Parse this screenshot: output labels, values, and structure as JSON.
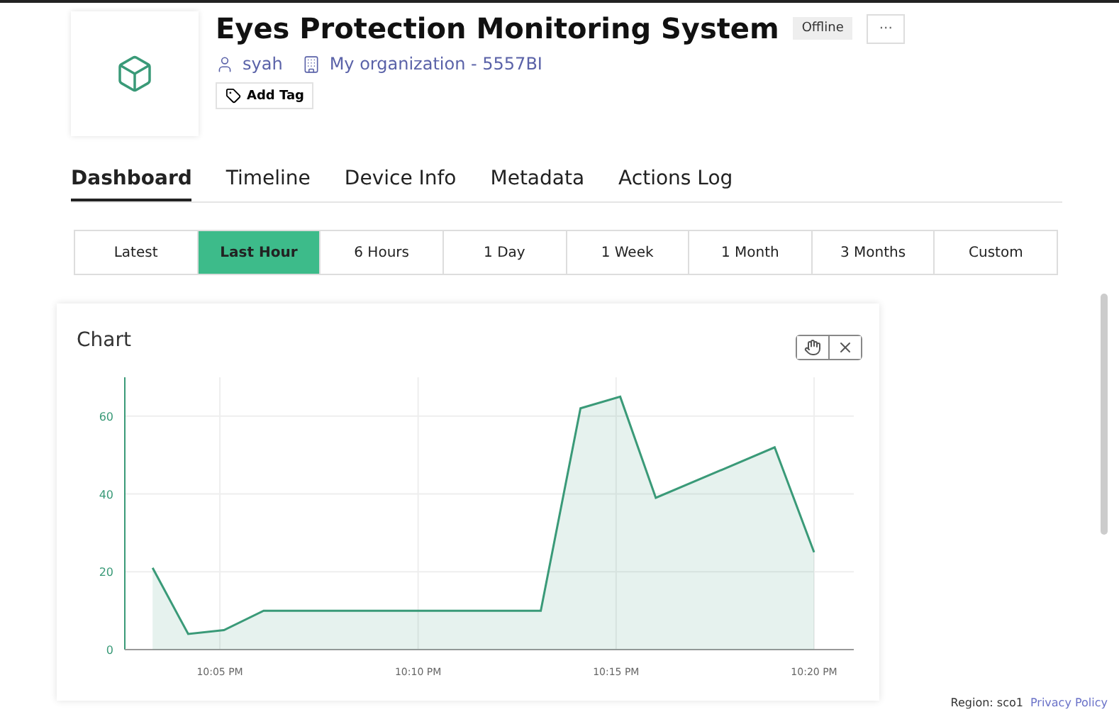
{
  "device": {
    "title": "Eyes Protection Monitoring System",
    "status": "Offline",
    "more": "···",
    "owner": "syah",
    "organization": "My organization - 5557BI",
    "add_tag": "Add Tag"
  },
  "tabs": [
    {
      "label": "Dashboard",
      "selected": true
    },
    {
      "label": "Timeline",
      "selected": false
    },
    {
      "label": "Device Info",
      "selected": false
    },
    {
      "label": "Metadata",
      "selected": false
    },
    {
      "label": "Actions Log",
      "selected": false
    }
  ],
  "ranges": [
    {
      "label": "Latest",
      "selected": false
    },
    {
      "label": "Last Hour",
      "selected": true
    },
    {
      "label": "6 Hours",
      "selected": false
    },
    {
      "label": "1 Day",
      "selected": false
    },
    {
      "label": "1 Week",
      "selected": false
    },
    {
      "label": "1 Month",
      "selected": false
    },
    {
      "label": "3 Months",
      "selected": false
    },
    {
      "label": "Custom",
      "selected": false
    }
  ],
  "chart": {
    "title": "Chart",
    "chart_data": {
      "type": "area",
      "grid": true,
      "x": [
        22.055,
        22.07,
        22.085,
        22.1017,
        22.2183,
        22.235,
        22.2517,
        22.2667,
        22.3167,
        22.3333
      ],
      "series": [
        {
          "color": "#3a9a78",
          "values": [
            21,
            4,
            5,
            10,
            10,
            62,
            65,
            39,
            52,
            25
          ]
        }
      ],
      "ylim": [
        0,
        70
      ],
      "xlim": [
        22.0433,
        22.35
      ],
      "yticks": [
        0,
        20,
        40,
        60
      ],
      "xticks": [
        {
          "value": 22.0833,
          "label": "10:05 PM"
        },
        {
          "value": 22.1667,
          "label": "10:10 PM"
        },
        {
          "value": 22.25,
          "label": "10:15 PM"
        },
        {
          "value": 22.3333,
          "label": "10:20 PM"
        }
      ]
    }
  },
  "footer": {
    "region": "Region: sco1",
    "privacy": "Privacy Policy"
  }
}
